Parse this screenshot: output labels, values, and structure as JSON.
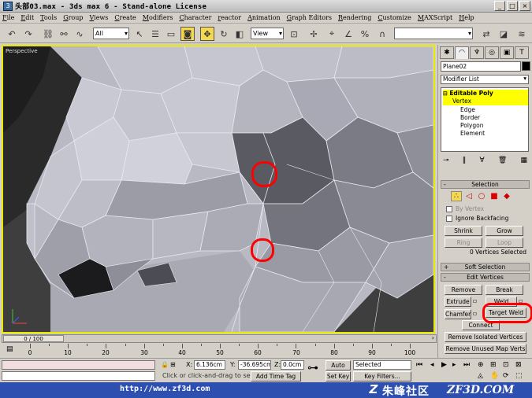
{
  "window": {
    "title": "头部03.max - 3ds max 6 - Stand-alone License",
    "controls": [
      "_",
      "□",
      "×"
    ]
  },
  "menu": [
    "File",
    "Edit",
    "Tools",
    "Group",
    "Views",
    "Create",
    "Modifiers",
    "Character",
    "reactor",
    "Animation",
    "Graph Editors",
    "Rendering",
    "Customize",
    "MAXScript",
    "Help"
  ],
  "toolbar": {
    "selection_filter": "All",
    "reference_coord": "View",
    "named_selection": ""
  },
  "viewport": {
    "label": "Perspective",
    "border_color": "#e8e800",
    "highlight_color": "#ff0000"
  },
  "command_panel": {
    "object_name": "Plane02",
    "object_color": "#000000",
    "modifier_list": "Modifier List",
    "stack": [
      "Editable Poly",
      "Vertex",
      "Edge",
      "Border",
      "Polygon",
      "Element"
    ],
    "selection": {
      "header": "Selection",
      "by_vertex": "By Vertex",
      "ignore_backfacing": "Ignore Backfacing",
      "shrink": "Shrink",
      "grow": "Grow",
      "ring": "Ring",
      "loop": "Loop",
      "status": "0 Vertices Selected"
    },
    "soft_selection": "Soft Selection",
    "edit_vertices": {
      "header": "Edit Vertices",
      "remove": "Remove",
      "break": "Break",
      "extrude": "Extrude",
      "weld": "Weld",
      "chamfer": "Chamfer",
      "target_weld": "Target Weld",
      "connect": "Connect",
      "remove_isolated": "Remove Isolated Vertices",
      "remove_unused": "Remove Unused Map Verts"
    }
  },
  "timeline": {
    "slider": "0 / 100",
    "labels": [
      "0",
      "10",
      "20",
      "30",
      "40",
      "50",
      "60",
      "70",
      "80",
      "90",
      "100"
    ]
  },
  "status": {
    "x_label": "X:",
    "x_value": "6.136cm",
    "y_label": "Y:",
    "y_value": "-36.695cm",
    "z_label": "Z:",
    "z_value": "0.0cm",
    "auto_key": "Auto Key",
    "set_key": "Set Key",
    "key_mode": "Selected",
    "key_filters": "Key Filters...",
    "add_time_tag": "Add Time Tag",
    "prompt": "Click or click-and-drag to select ob"
  },
  "watermark": {
    "url": "http://www.zf3d.com",
    "logo": "Z",
    "cn": "朱峰社区",
    "site": "ZF3D.COM"
  }
}
